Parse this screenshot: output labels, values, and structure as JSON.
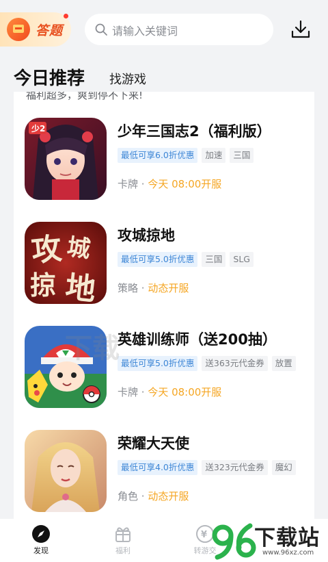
{
  "header": {
    "quiz_badge": "答题",
    "search_placeholder": "请输入关键词"
  },
  "tabs": [
    {
      "label": "今日推荐",
      "active": true
    },
    {
      "label": "找游戏",
      "active": false
    }
  ],
  "section_subtitle": "福利超多，爽到停不下来!",
  "games": [
    {
      "title": "少年三国志2（福利版）",
      "tags": [
        "最低可享6.0折优惠",
        "加速",
        "三国"
      ],
      "genre": "卡牌 · ",
      "open_time": "今天 08:00开服",
      "icon": "shaonian-sanguozhi-icon"
    },
    {
      "title": "攻城掠地",
      "tags": [
        "最低可享5.0折优惠",
        "三国",
        "SLG"
      ],
      "genre": "策略 · ",
      "open_time": "动态开服",
      "icon": "gongcheng-luedi-icon"
    },
    {
      "title": "英雄训练师（送200抽）",
      "tags": [
        "最低可享5.0折优惠",
        "送363元代金券",
        "放置"
      ],
      "genre": "卡牌 · ",
      "open_time": "今天 08:00开服",
      "icon": "yingxiong-xunlianshi-icon"
    },
    {
      "title": "荣耀大天使",
      "tags": [
        "最低可享4.0折优惠",
        "送323元代金券",
        "魔幻"
      ],
      "genre": "角色 · ",
      "open_time": "动态开服",
      "icon": "rongyao-datianshi-icon"
    }
  ],
  "bottom_nav": [
    {
      "label": "发现",
      "icon": "compass-icon",
      "active": true
    },
    {
      "label": "福利",
      "icon": "gift-icon",
      "active": false
    },
    {
      "label": "转游交",
      "icon": "exchange-icon",
      "active": false
    }
  ],
  "watermark": {
    "brand": "下载站",
    "url": "www.96xz.com"
  },
  "colors": {
    "accent_orange": "#f5a623",
    "discount_blue": "#3d86d6",
    "background": "#f2f3f5"
  }
}
